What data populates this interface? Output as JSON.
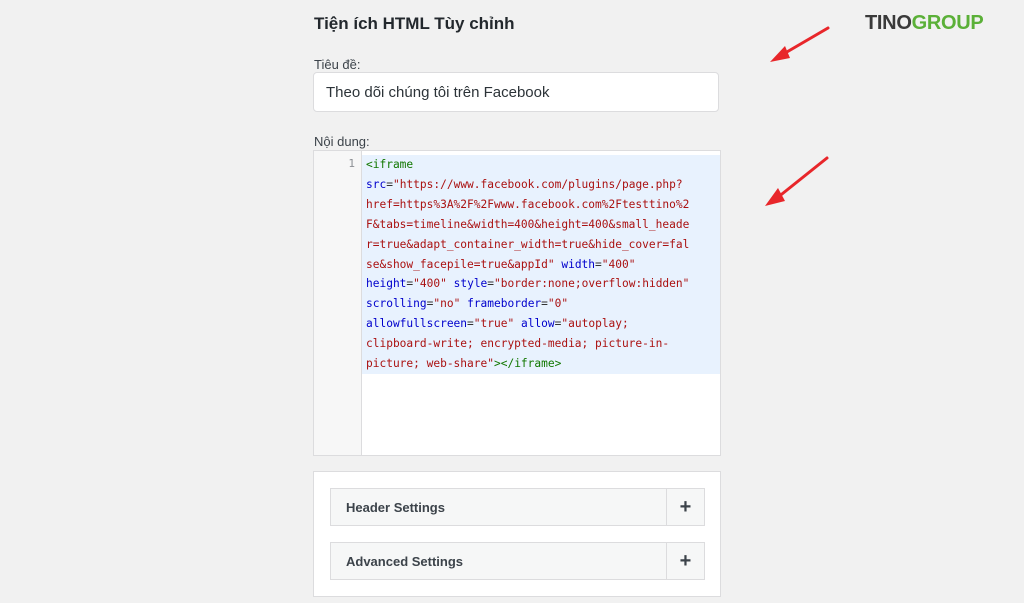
{
  "widget": {
    "title": "Tiện ích HTML Tùy chỉnh"
  },
  "title_field": {
    "label": "Tiêu đề:",
    "value": "Theo dõi chúng tôi trên Facebook"
  },
  "content_field": {
    "label": "Nội dung:",
    "line_number": "1",
    "code_lines": [
      [
        [
          "tag",
          "<iframe"
        ]
      ],
      [
        [
          "attr",
          "src"
        ],
        [
          "plain",
          "="
        ],
        [
          "str",
          "\"https://www.facebook.com/plugins/page.php?"
        ]
      ],
      [
        [
          "str",
          "href=https%3A%2F%2Fwww.facebook.com%2Ftesttino%2"
        ]
      ],
      [
        [
          "str",
          "F&tabs=timeline&width=400&height=400&small_heade"
        ]
      ],
      [
        [
          "str",
          "r=true&adapt_container_width=true&hide_cover=fal"
        ]
      ],
      [
        [
          "str",
          "se&show_facepile=true&appId\""
        ],
        [
          "plain",
          " "
        ],
        [
          "attr",
          "width"
        ],
        [
          "plain",
          "="
        ],
        [
          "str",
          "\"400\""
        ]
      ],
      [
        [
          "attr",
          "height"
        ],
        [
          "plain",
          "="
        ],
        [
          "str",
          "\"400\""
        ],
        [
          "plain",
          " "
        ],
        [
          "attr",
          "style"
        ],
        [
          "plain",
          "="
        ],
        [
          "str",
          "\"border:none;overflow:hidden\""
        ]
      ],
      [
        [
          "attr",
          "scrolling"
        ],
        [
          "plain",
          "="
        ],
        [
          "str",
          "\"no\""
        ],
        [
          "plain",
          " "
        ],
        [
          "attr",
          "frameborder"
        ],
        [
          "plain",
          "="
        ],
        [
          "str",
          "\"0\""
        ]
      ],
      [
        [
          "attr",
          "allowfullscreen"
        ],
        [
          "plain",
          "="
        ],
        [
          "str",
          "\"true\""
        ],
        [
          "plain",
          " "
        ],
        [
          "attr",
          "allow"
        ],
        [
          "plain",
          "="
        ],
        [
          "str",
          "\"autoplay;"
        ]
      ],
      [
        [
          "str",
          "clipboard-write; encrypted-media; picture-in-"
        ]
      ],
      [
        [
          "str",
          "picture; web-share\""
        ],
        [
          "tag",
          "></iframe>"
        ]
      ]
    ]
  },
  "settings": {
    "header_label": "Header Settings",
    "advanced_label": "Advanced Settings",
    "expand_symbol": "+"
  },
  "logo": {
    "part1": "TINO",
    "part2": "GROUP"
  },
  "colors": {
    "arrow": "#e8262a",
    "logo_green": "#5bb038",
    "code_bg": "#e8f2fe"
  }
}
